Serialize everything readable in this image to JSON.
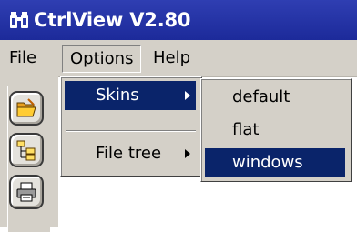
{
  "window": {
    "title": "CtrlView V2.80",
    "app_icon": "binoculars-icon"
  },
  "menubar": {
    "items": [
      {
        "label": "File"
      },
      {
        "label": "Options"
      },
      {
        "label": "Help"
      }
    ]
  },
  "options_menu": {
    "items": [
      {
        "label": "Skins",
        "has_submenu": true,
        "highlighted": true
      },
      {
        "label": "File tree",
        "has_submenu": true,
        "highlighted": false
      }
    ]
  },
  "skins_submenu": {
    "items": [
      {
        "label": "default",
        "highlighted": false
      },
      {
        "label": "flat",
        "highlighted": false
      },
      {
        "label": "windows",
        "highlighted": true
      }
    ]
  },
  "toolbar": {
    "buttons": [
      {
        "icon": "open-folder-icon"
      },
      {
        "icon": "file-tree-icon"
      },
      {
        "icon": "printer-icon"
      }
    ]
  },
  "colors": {
    "titlebar": "#1c2a9a",
    "highlight": "#0a246a",
    "face": "#d4d0c8"
  }
}
